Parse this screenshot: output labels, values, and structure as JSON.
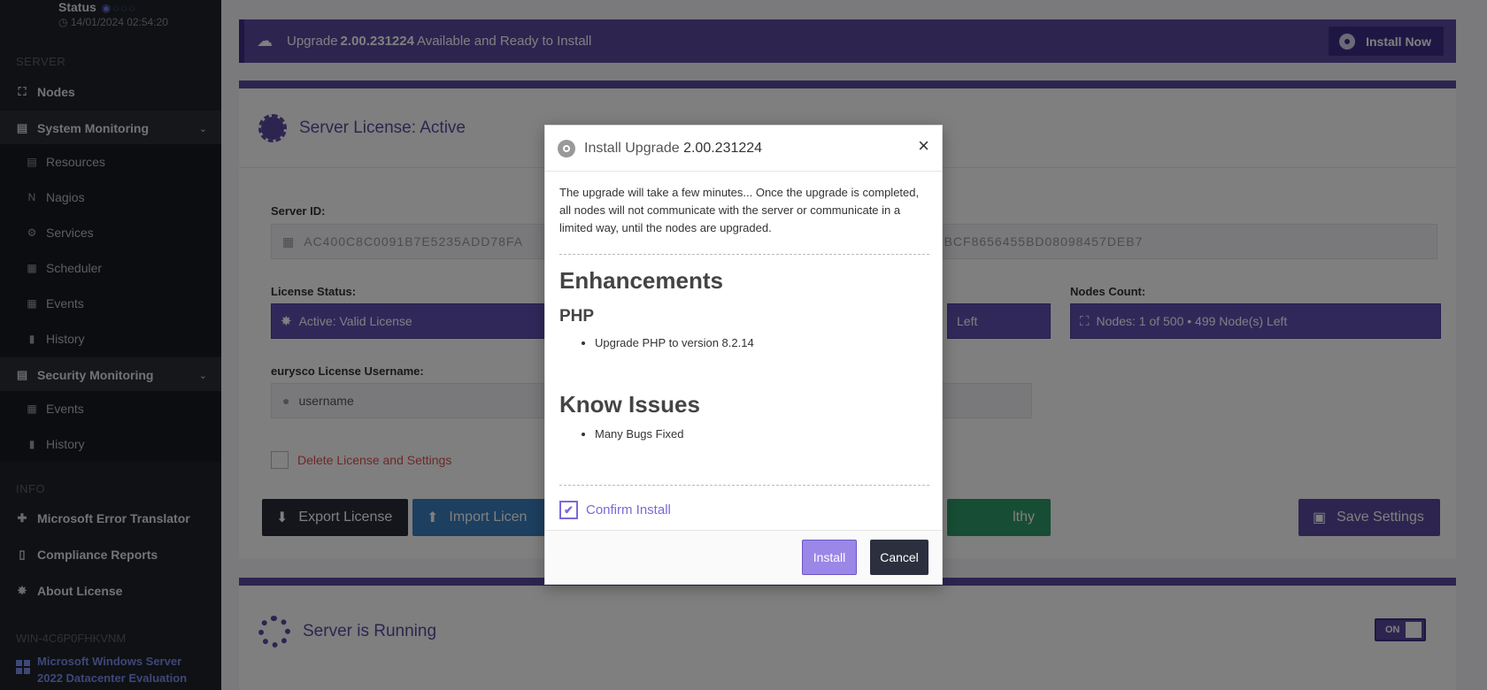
{
  "sidebar": {
    "status_label": "Status",
    "status_dots": "◉◌◌◌",
    "datetime": "14/01/2024 02:54:20",
    "section_server": "SERVER",
    "section_info": "INFO",
    "nodes": "Nodes",
    "system_monitoring": "System Monitoring",
    "system_sub": {
      "resources": "Resources",
      "nagios": "Nagios",
      "services": "Services",
      "scheduler": "Scheduler",
      "events": "Events",
      "history": "History"
    },
    "security_monitoring": "Security Monitoring",
    "security_sub": {
      "events": "Events",
      "history": "History"
    },
    "error_translator": "Microsoft Error Translator",
    "compliance_reports": "Compliance Reports",
    "about_license": "About License",
    "hostname": "WIN-4C6P0FHKVNM",
    "os_line1": "Microsoft  Windows  Server",
    "os_line2": "2022  Datacenter  Evaluation"
  },
  "upgrade_bar": {
    "prefix": "Upgrade",
    "version": "2.00.231224",
    "suffix": "Available and Ready to Install",
    "install_now": "Install Now"
  },
  "license_panel": {
    "title": "Server License: Active",
    "server_id_label": "Server ID:",
    "server_id_left": "AC400C8C0091B7E5235ADD78FA",
    "server_id_right": "35BCF8656455BD08098457DEB7",
    "license_status_label": "License Status:",
    "license_status_value": "Active: Valid License",
    "middle_box_tail": "Left",
    "nodes_count_label": "Nodes Count:",
    "nodes_count_value": "Nodes: 1 of 500 • 499 Node(s) Left",
    "username_label": "eurysco License Username:",
    "username_placeholder": "username",
    "delete_label": "Delete License and Settings",
    "export_btn": "Export License",
    "import_btn": "Import Licen",
    "healthy_tail": "lthy",
    "save_btn": "Save Settings"
  },
  "running_panel": {
    "title": "Server is Running",
    "toggle": "ON"
  },
  "modal": {
    "title_prefix": "Install Upgrade",
    "title_version": "2.00.231224",
    "close": "×",
    "intro": "The upgrade will take a few minutes... Once the upgrade is completed, all nodes will not communicate with the server or communicate in a limited way, until the nodes are upgraded.",
    "enhancements_heading": "Enhancements",
    "php_heading": "PHP",
    "php_items": [
      "Upgrade PHP to version 8.2.14"
    ],
    "issues_heading": "Know Issues",
    "issues_items": [
      "Many Bugs Fixed"
    ],
    "confirm_label": "Confirm Install",
    "confirm_checked": true,
    "install_btn": "Install",
    "cancel_btn": "Cancel"
  },
  "colors": {
    "accent": "#5a4ba0",
    "sidebar_bg": "#1f2229",
    "install_btn": "#9a87e8",
    "cancel_btn": "#2c2f3d",
    "danger": "#d9534f"
  }
}
